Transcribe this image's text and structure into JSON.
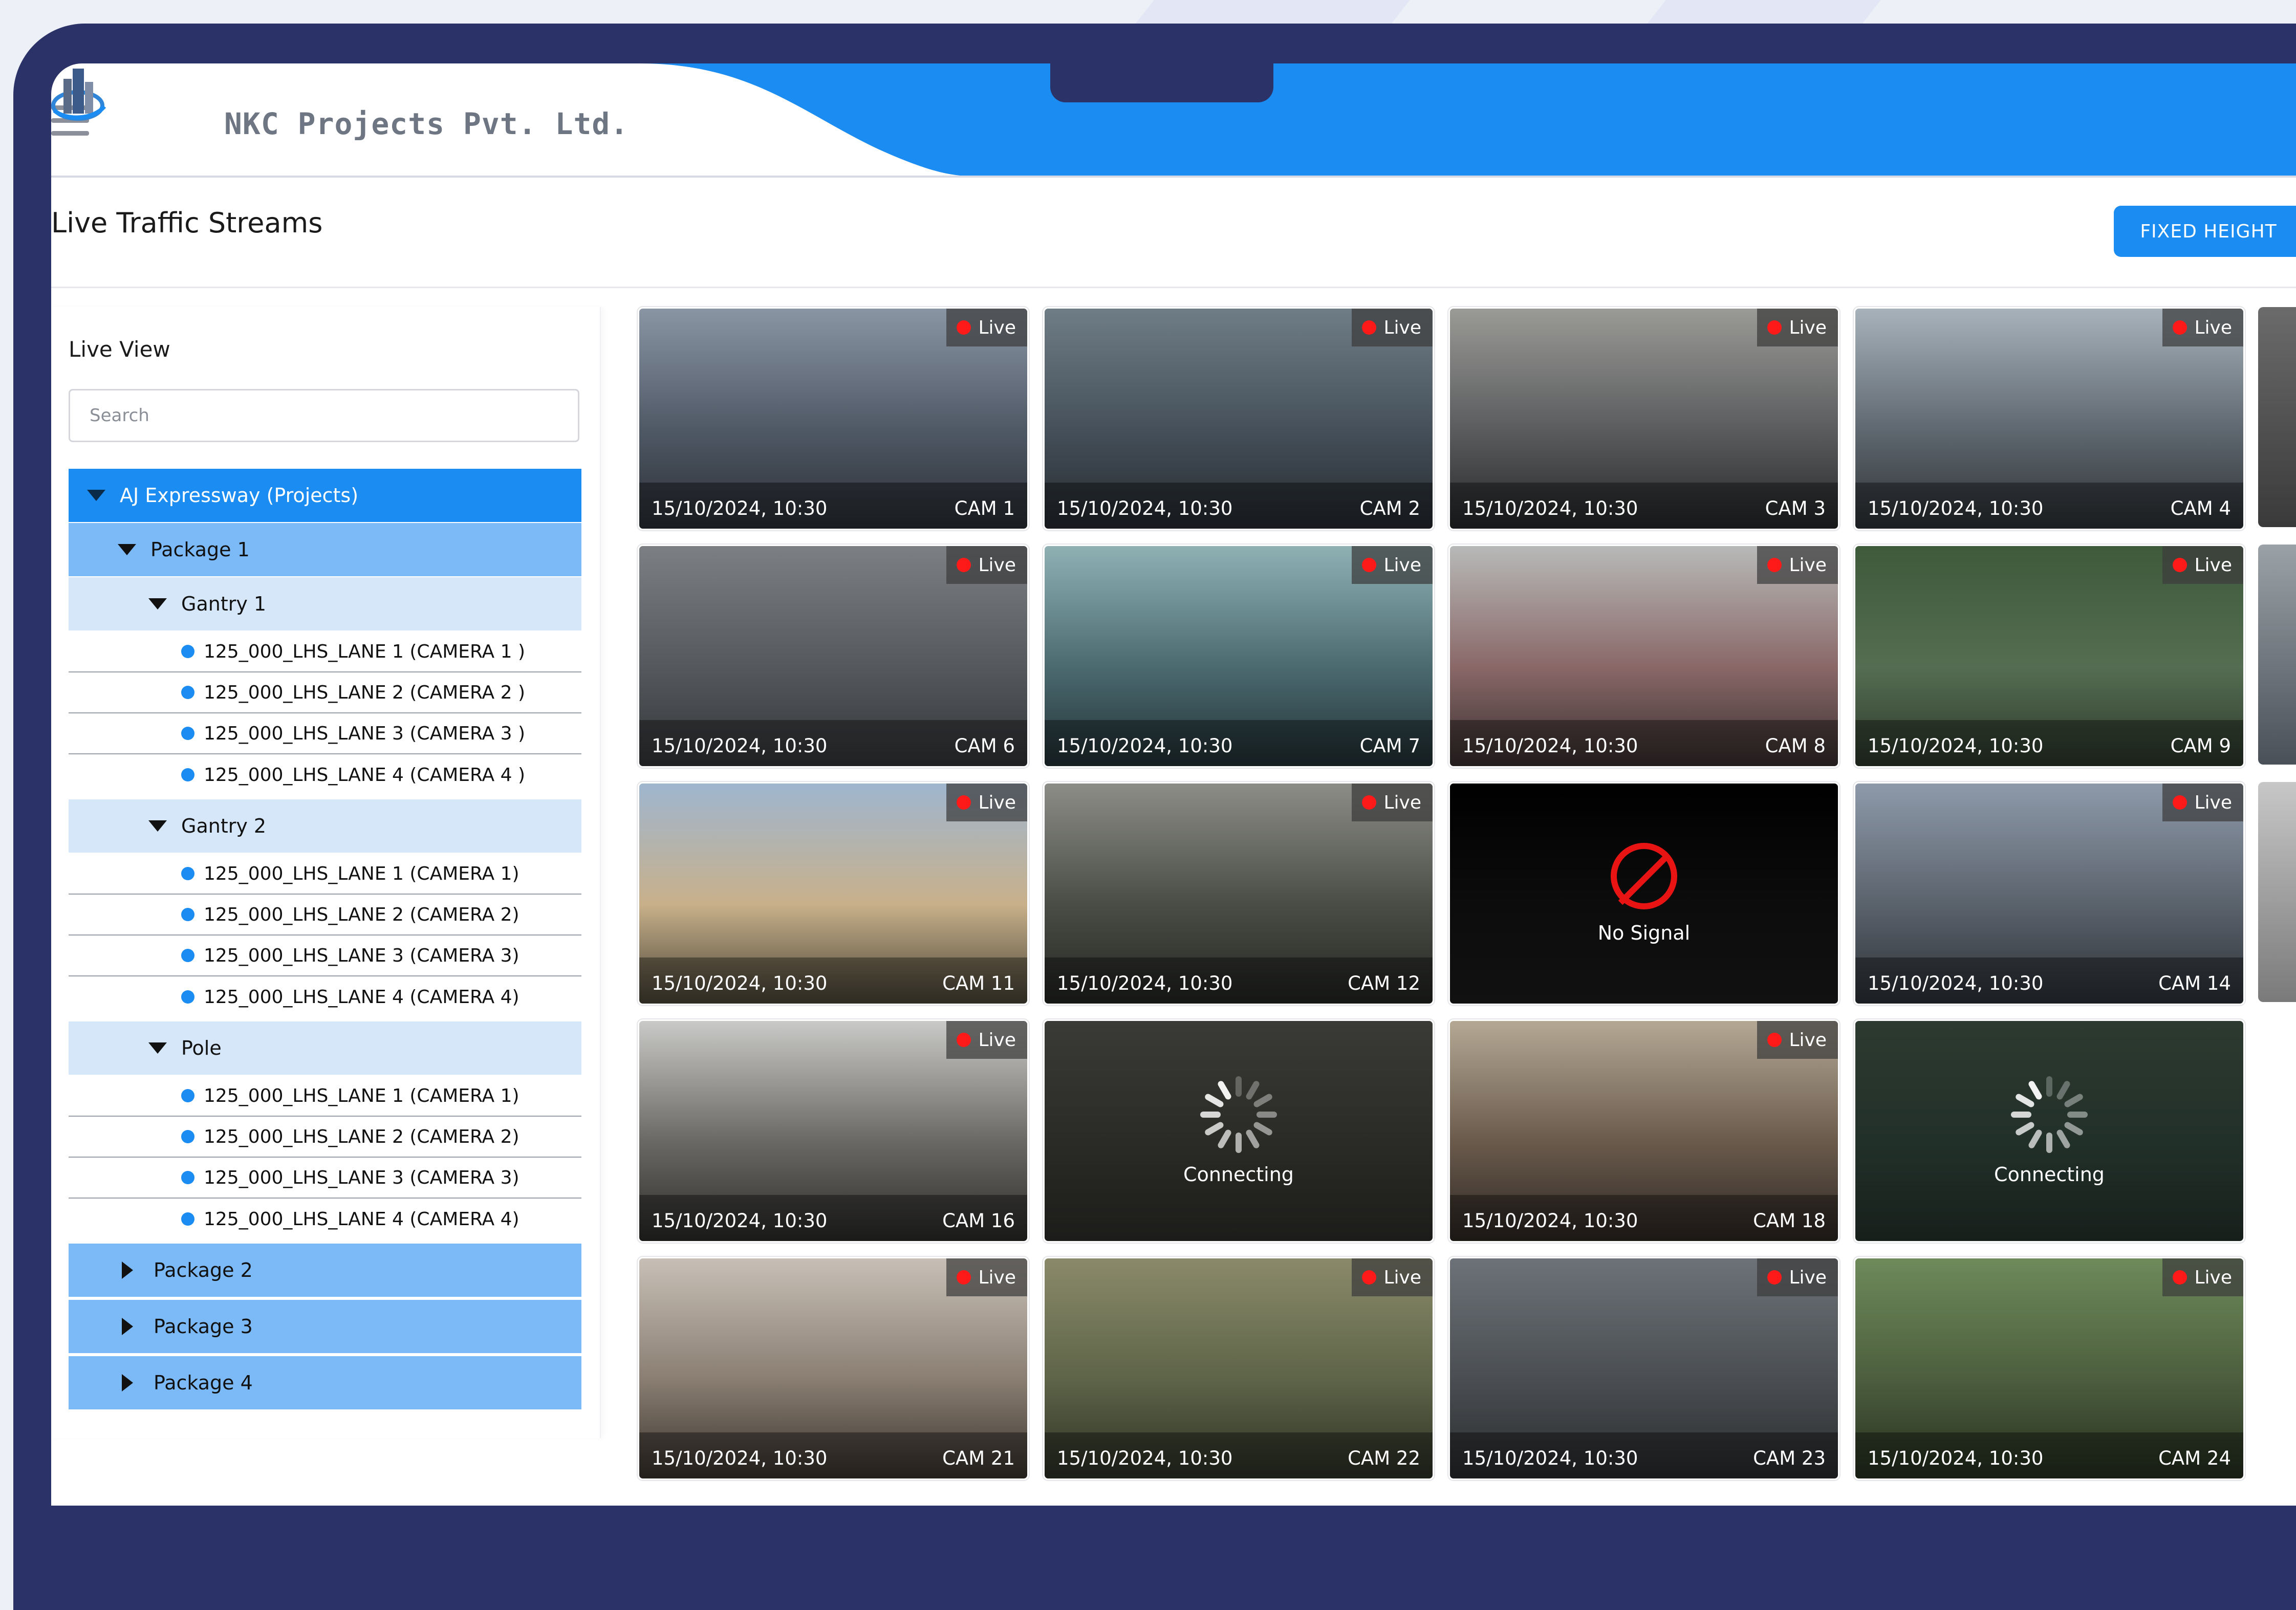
{
  "brand": {
    "company_name": "NKC Projects Pvt. Ltd."
  },
  "header": {
    "page_title": "Live Traffic Streams",
    "fixed_height_label": "FIXED HEIGHT"
  },
  "sidebar": {
    "title": "Live View",
    "search_placeholder": "Search",
    "project": {
      "label": "AJ Expressway (Projects)",
      "packages": [
        {
          "label": "Package 1",
          "expanded": true,
          "groups": [
            {
              "label": "Gantry 1",
              "cameras": [
                "125_000_LHS_LANE 1 (CAMERA 1 )",
                "125_000_LHS_LANE 2 (CAMERA 2 )",
                "125_000_LHS_LANE 3 (CAMERA 3 )",
                "125_000_LHS_LANE 4 (CAMERA 4 )"
              ]
            },
            {
              "label": "Gantry 2",
              "cameras": [
                "125_000_LHS_LANE 1 (CAMERA 1)",
                "125_000_LHS_LANE 2 (CAMERA 2)",
                "125_000_LHS_LANE 3 (CAMERA 3)",
                "125_000_LHS_LANE 4 (CAMERA 4)"
              ]
            },
            {
              "label": "Pole",
              "cameras": [
                "125_000_LHS_LANE 1 (CAMERA 1)",
                "125_000_LHS_LANE 2 (CAMERA 2)",
                "125_000_LHS_LANE 3 (CAMERA 3)",
                "125_000_LHS_LANE 4 (CAMERA 4)"
              ]
            }
          ]
        },
        {
          "label": "Package 2",
          "expanded": false
        },
        {
          "label": "Package 3",
          "expanded": false
        },
        {
          "label": "Package 4",
          "expanded": false
        }
      ]
    }
  },
  "streams": [
    {
      "cam": "CAM 1",
      "status": "live",
      "live_label": "Live",
      "timestamp": "15/10/2024, 10:30"
    },
    {
      "cam": "CAM 2",
      "status": "live",
      "live_label": "Live",
      "timestamp": "15/10/2024, 10:30"
    },
    {
      "cam": "CAM 3",
      "status": "live",
      "live_label": "Live",
      "timestamp": "15/10/2024, 10:30"
    },
    {
      "cam": "CAM 4",
      "status": "live",
      "live_label": "Live",
      "timestamp": "15/10/2024, 10:30"
    },
    {
      "cam": "CAM 6",
      "status": "live",
      "live_label": "Live",
      "timestamp": "15/10/2024, 10:30"
    },
    {
      "cam": "CAM 7",
      "status": "live",
      "live_label": "Live",
      "timestamp": "15/10/2024, 10:30"
    },
    {
      "cam": "CAM 8",
      "status": "live",
      "live_label": "Live",
      "timestamp": "15/10/2024, 10:30"
    },
    {
      "cam": "CAM 9",
      "status": "live",
      "live_label": "Live",
      "timestamp": "15/10/2024, 10:30"
    },
    {
      "cam": "CAM 11",
      "status": "live",
      "live_label": "Live",
      "timestamp": "15/10/2024, 10:30"
    },
    {
      "cam": "CAM 12",
      "status": "live",
      "live_label": "Live",
      "timestamp": "15/10/2024, 10:30"
    },
    {
      "cam": "",
      "status": "no-signal",
      "message": "No Signal"
    },
    {
      "cam": "CAM 14",
      "status": "live",
      "live_label": "Live",
      "timestamp": "15/10/2024, 10:30"
    },
    {
      "cam": "CAM 16",
      "status": "live",
      "live_label": "Live",
      "timestamp": "15/10/2024, 10:30"
    },
    {
      "cam": "",
      "status": "connecting",
      "message": "Connecting"
    },
    {
      "cam": "CAM 18",
      "status": "live",
      "live_label": "Live",
      "timestamp": "15/10/2024, 10:30"
    },
    {
      "cam": "",
      "status": "connecting",
      "message": "Connecting"
    },
    {
      "cam": "CAM 21",
      "status": "live",
      "live_label": "Live",
      "timestamp": "15/10/2024, 10:30"
    },
    {
      "cam": "CAM 22",
      "status": "live",
      "live_label": "Live",
      "timestamp": "15/10/2024, 10:30"
    },
    {
      "cam": "CAM 23",
      "status": "live",
      "live_label": "Live",
      "timestamp": "15/10/2024, 10:30"
    },
    {
      "cam": "CAM 24",
      "status": "live",
      "live_label": "Live",
      "timestamp": "15/10/2024, 10:30"
    }
  ],
  "icons": {
    "menu": "hamburger-icon",
    "logo": "building-logo-icon",
    "live": "live-dot-icon",
    "no_signal": "no-signal-icon",
    "connecting": "spinner-icon",
    "expand": "caret-down-icon",
    "collapse": "caret-right-icon",
    "camera": "camera-dot-icon"
  },
  "colors": {
    "primary": "#1b8cf2",
    "frame": "#2a3268",
    "package": "#7cbaf7",
    "group": "#d6e7fa",
    "live_dot": "#ff1a1a",
    "no_signal": "#e81414"
  }
}
